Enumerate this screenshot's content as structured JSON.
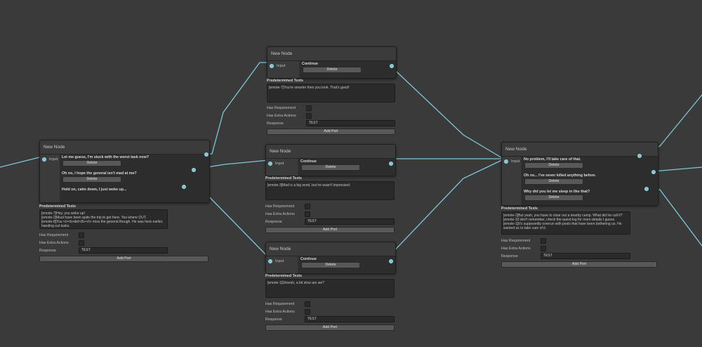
{
  "colors": {
    "background": "#3a3a3a",
    "edge": "#7ec8d6",
    "node": "#393939"
  },
  "labels": {
    "new_node": "New Node",
    "input": "Input",
    "delete": "Delete",
    "predetermined": "Predetermined Texts",
    "has_requirement": "Has Requirement",
    "has_extra_actions": "Has Extra Actions",
    "response": "Response",
    "add_port": "Add Port"
  },
  "nodes": [
    {
      "title": "New Node",
      "choices": [
        "Let me guess, I'm stuck with the worst task now?",
        "Oh no, I hope the general isn't mad at me?",
        "Hold on, calm down, I just woke up..."
      ],
      "text": "[emote-7]Hey, you woke up!\n[emote-2]Must have been quite the trip to get here. You where OUT.\n[emote-8]You <i><b>did</b></i> miss the general though. He was here earlier, handing out tasks.",
      "response": "TEST"
    },
    {
      "title": "New Node",
      "choices": [
        "Continue"
      ],
      "text": "[emote-7]You're smarter then you look. That's good!",
      "response": "TEST"
    },
    {
      "title": "New Node",
      "choices": [
        "Continue"
      ],
      "text": "[emote-3]Mad is a big word, but he wasn't impressed.",
      "response": "TEST"
    },
    {
      "title": "New Node",
      "choices": [
        "Continue"
      ],
      "text": "[emote-1]Sheesh, a bit slow are we?",
      "response": "TEST"
    },
    {
      "title": "New Node",
      "choices": [
        "No problem, I'll take care of that.",
        "Oh no... I've never killed anything before.",
        "Why did you let me sleep in like that?"
      ],
      "text": "[emote-2]But yeah, you have to clear out a nearby camp. What did he call it?\n[emote-33 don't remember, check the quest-log for more details I guess.\n[emote-1]It's supposedly overrun with pests that have been bothering us. He wanted us to take care of it.",
      "response": "TEST"
    }
  ]
}
